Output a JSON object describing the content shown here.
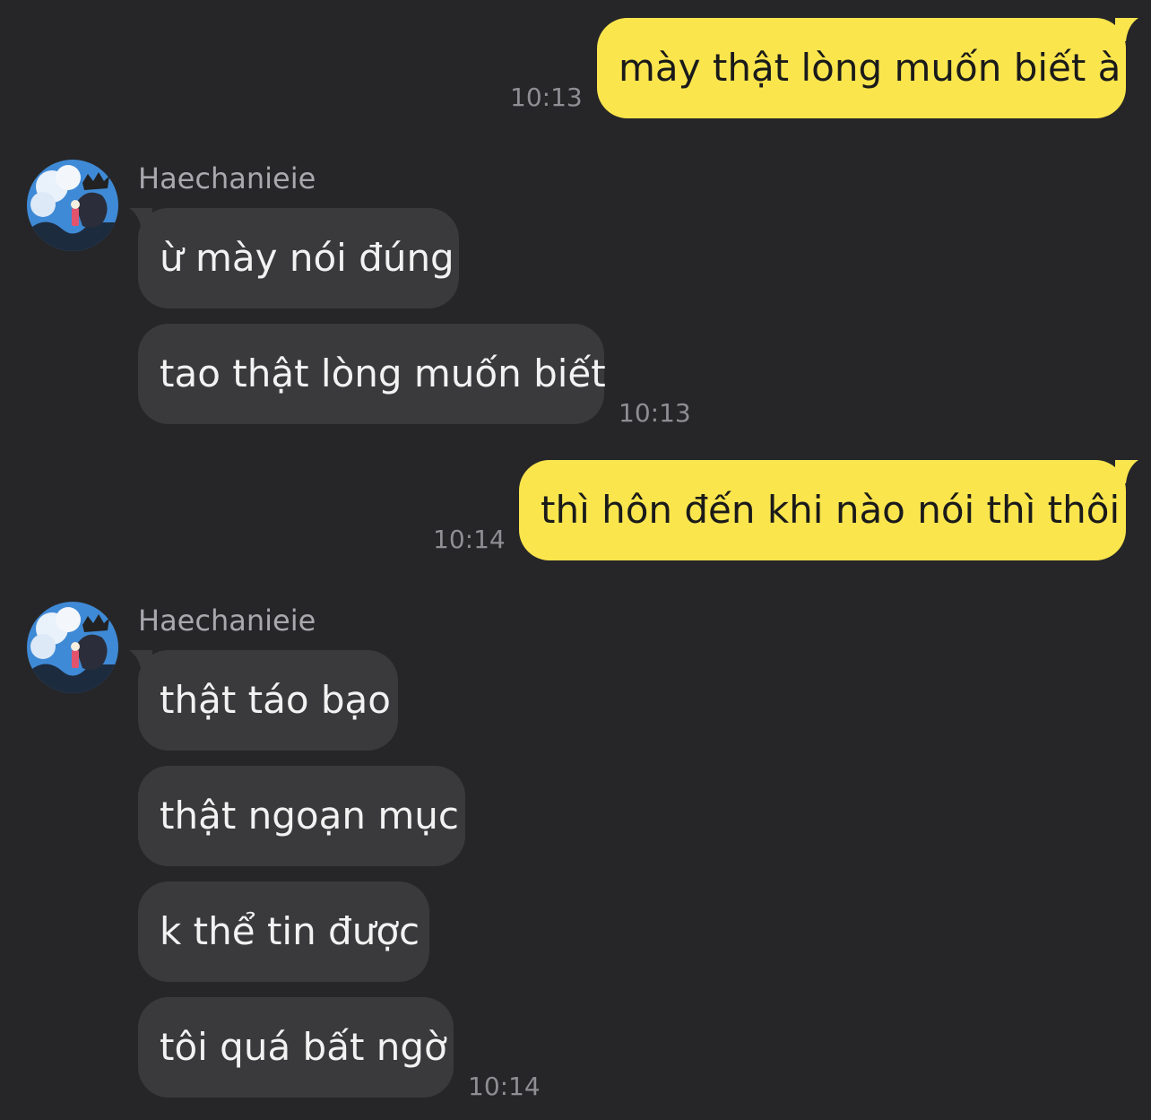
{
  "messages": [
    {
      "direction": "outgoing",
      "text": "mày thật lòng muốn biết à",
      "time": "10:13"
    },
    {
      "direction": "incoming",
      "sender": "Haechanieie",
      "bubbles": [
        "ừ mày nói đúng",
        "tao thật lòng muốn biết"
      ],
      "time": "10:13"
    },
    {
      "direction": "outgoing",
      "text": "thì hôn đến khi nào nói thì thôi",
      "time": "10:14"
    },
    {
      "direction": "incoming",
      "sender": "Haechanieie",
      "bubbles": [
        "thật táo bạo",
        "thật ngoạn mục",
        "k thể tin được",
        "tôi quá bất ngờ"
      ],
      "time": "10:14"
    }
  ],
  "colors": {
    "background": "#262628",
    "outgoing_bubble": "#fae54d",
    "incoming_bubble": "#3a3a3c",
    "timestamp": "#8e8e93",
    "sender_name": "#a8a8ad"
  },
  "icons": {
    "avatar": "avatar-photo-icon"
  }
}
